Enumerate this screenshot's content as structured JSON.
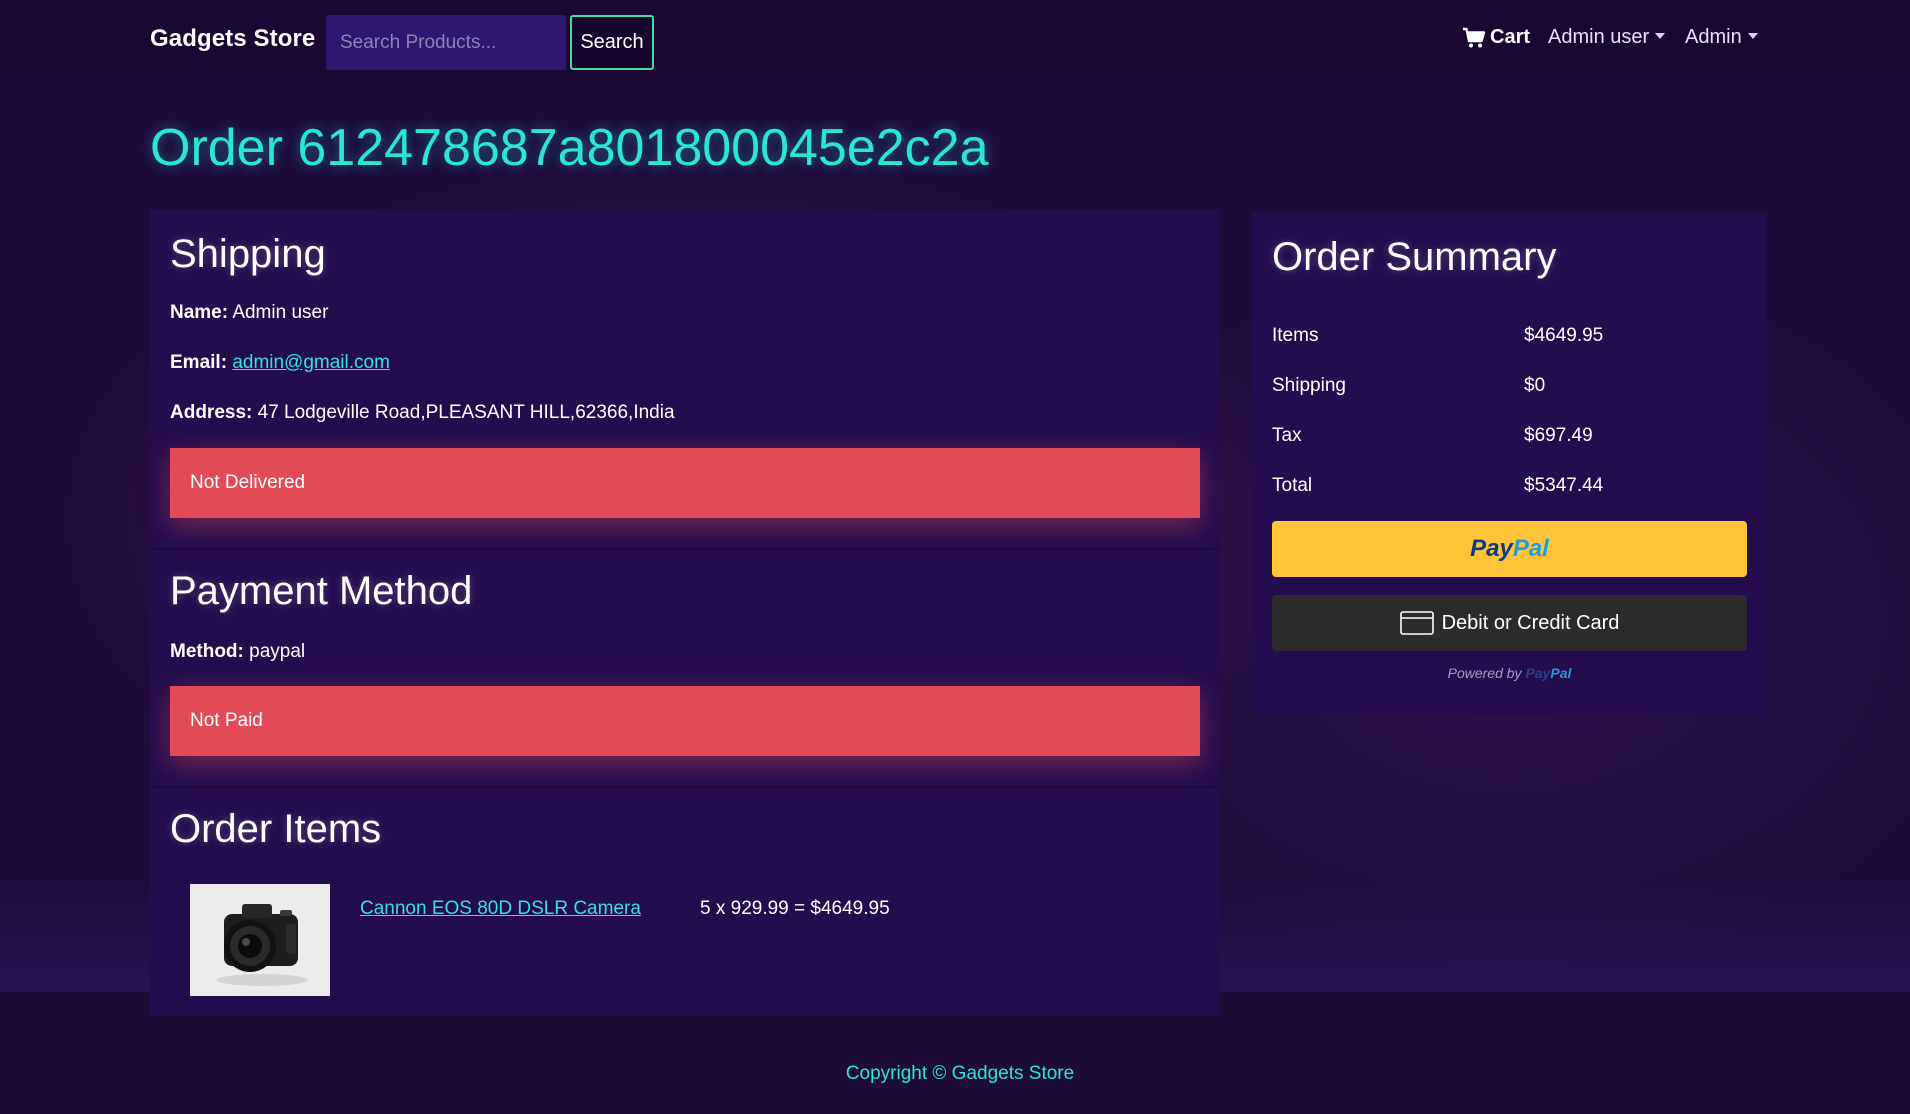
{
  "navbar": {
    "brand": "Gadgets Store",
    "search_placeholder": "Search Products...",
    "search_button": "Search",
    "cart_label": "Cart",
    "user_menu": "Admin user",
    "admin_menu": "Admin"
  },
  "page": {
    "title": "Order 612478687a801800045e2c2a"
  },
  "shipping": {
    "heading": "Shipping",
    "name_label": "Name:",
    "name_value": "Admin user",
    "email_label": "Email:",
    "email_value": "admin@gmail.com",
    "address_label": "Address:",
    "address_value": "47 Lodgeville Road,PLEASANT HILL,62366,India",
    "status": "Not Delivered"
  },
  "payment": {
    "heading": "Payment Method",
    "method_label": "Method:",
    "method_value": "paypal",
    "status": "Not Paid"
  },
  "order_items": {
    "heading": "Order Items",
    "items": [
      {
        "name": "Cannon EOS 80D DSLR Camera",
        "calc": "5 x 929.99 = $4649.95"
      }
    ]
  },
  "summary": {
    "heading": "Order Summary",
    "rows": [
      {
        "label": "Items",
        "value": "$4649.95"
      },
      {
        "label": "Shipping",
        "value": "$0"
      },
      {
        "label": "Tax",
        "value": "$697.49"
      },
      {
        "label": "Total",
        "value": "$5347.44"
      }
    ],
    "paypal_part1": "Pay",
    "paypal_part2": "Pal",
    "card_button": "Debit or Credit Card",
    "powered_by": "Powered by"
  },
  "footer": {
    "copyright": "Copyright © Gadgets Store"
  },
  "colors": {
    "accent": "#29e6d6",
    "danger": "#e24b55",
    "paypal_yellow": "#ffc43a",
    "background": "#1d0c3b",
    "panel": "#230d4e"
  },
  "icons": {
    "cart": "cart-icon",
    "card": "credit-card-icon",
    "caret": "caret-down-icon",
    "product": "camera-icon"
  }
}
